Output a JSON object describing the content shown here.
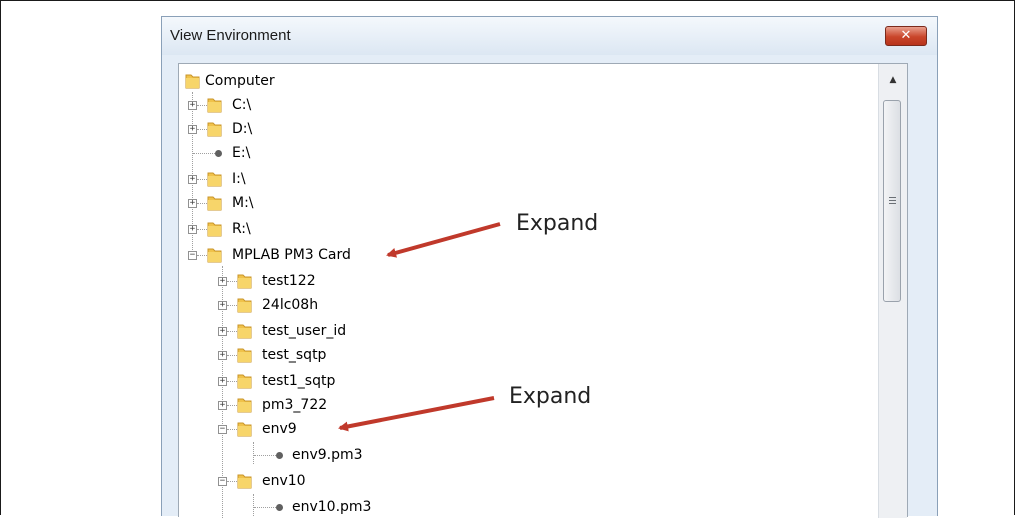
{
  "window": {
    "title": "View Environment",
    "close_label": "✕"
  },
  "tree": {
    "root": "Computer",
    "drives": [
      "C:\\",
      "D:\\",
      "E:\\",
      "I:\\",
      "M:\\",
      "R:\\"
    ],
    "card": {
      "label": "MPLAB PM3 Card",
      "children": [
        "test122",
        "24lc08h",
        "test_user_id",
        "test_sqtp",
        "test1_sqtp",
        "pm3_722",
        "env9",
        "env10"
      ],
      "files": {
        "env9": "env9.pm3",
        "env10": "env10.pm3"
      }
    }
  },
  "annotations": {
    "expand_1": "Expand",
    "expand_2": "Expand",
    "arrow_color": "#c0392b"
  },
  "icons": {
    "folder": "folder-icon",
    "file": "file-bullet-icon",
    "expand": "plus-box-icon",
    "collapse": "minus-box-icon"
  }
}
